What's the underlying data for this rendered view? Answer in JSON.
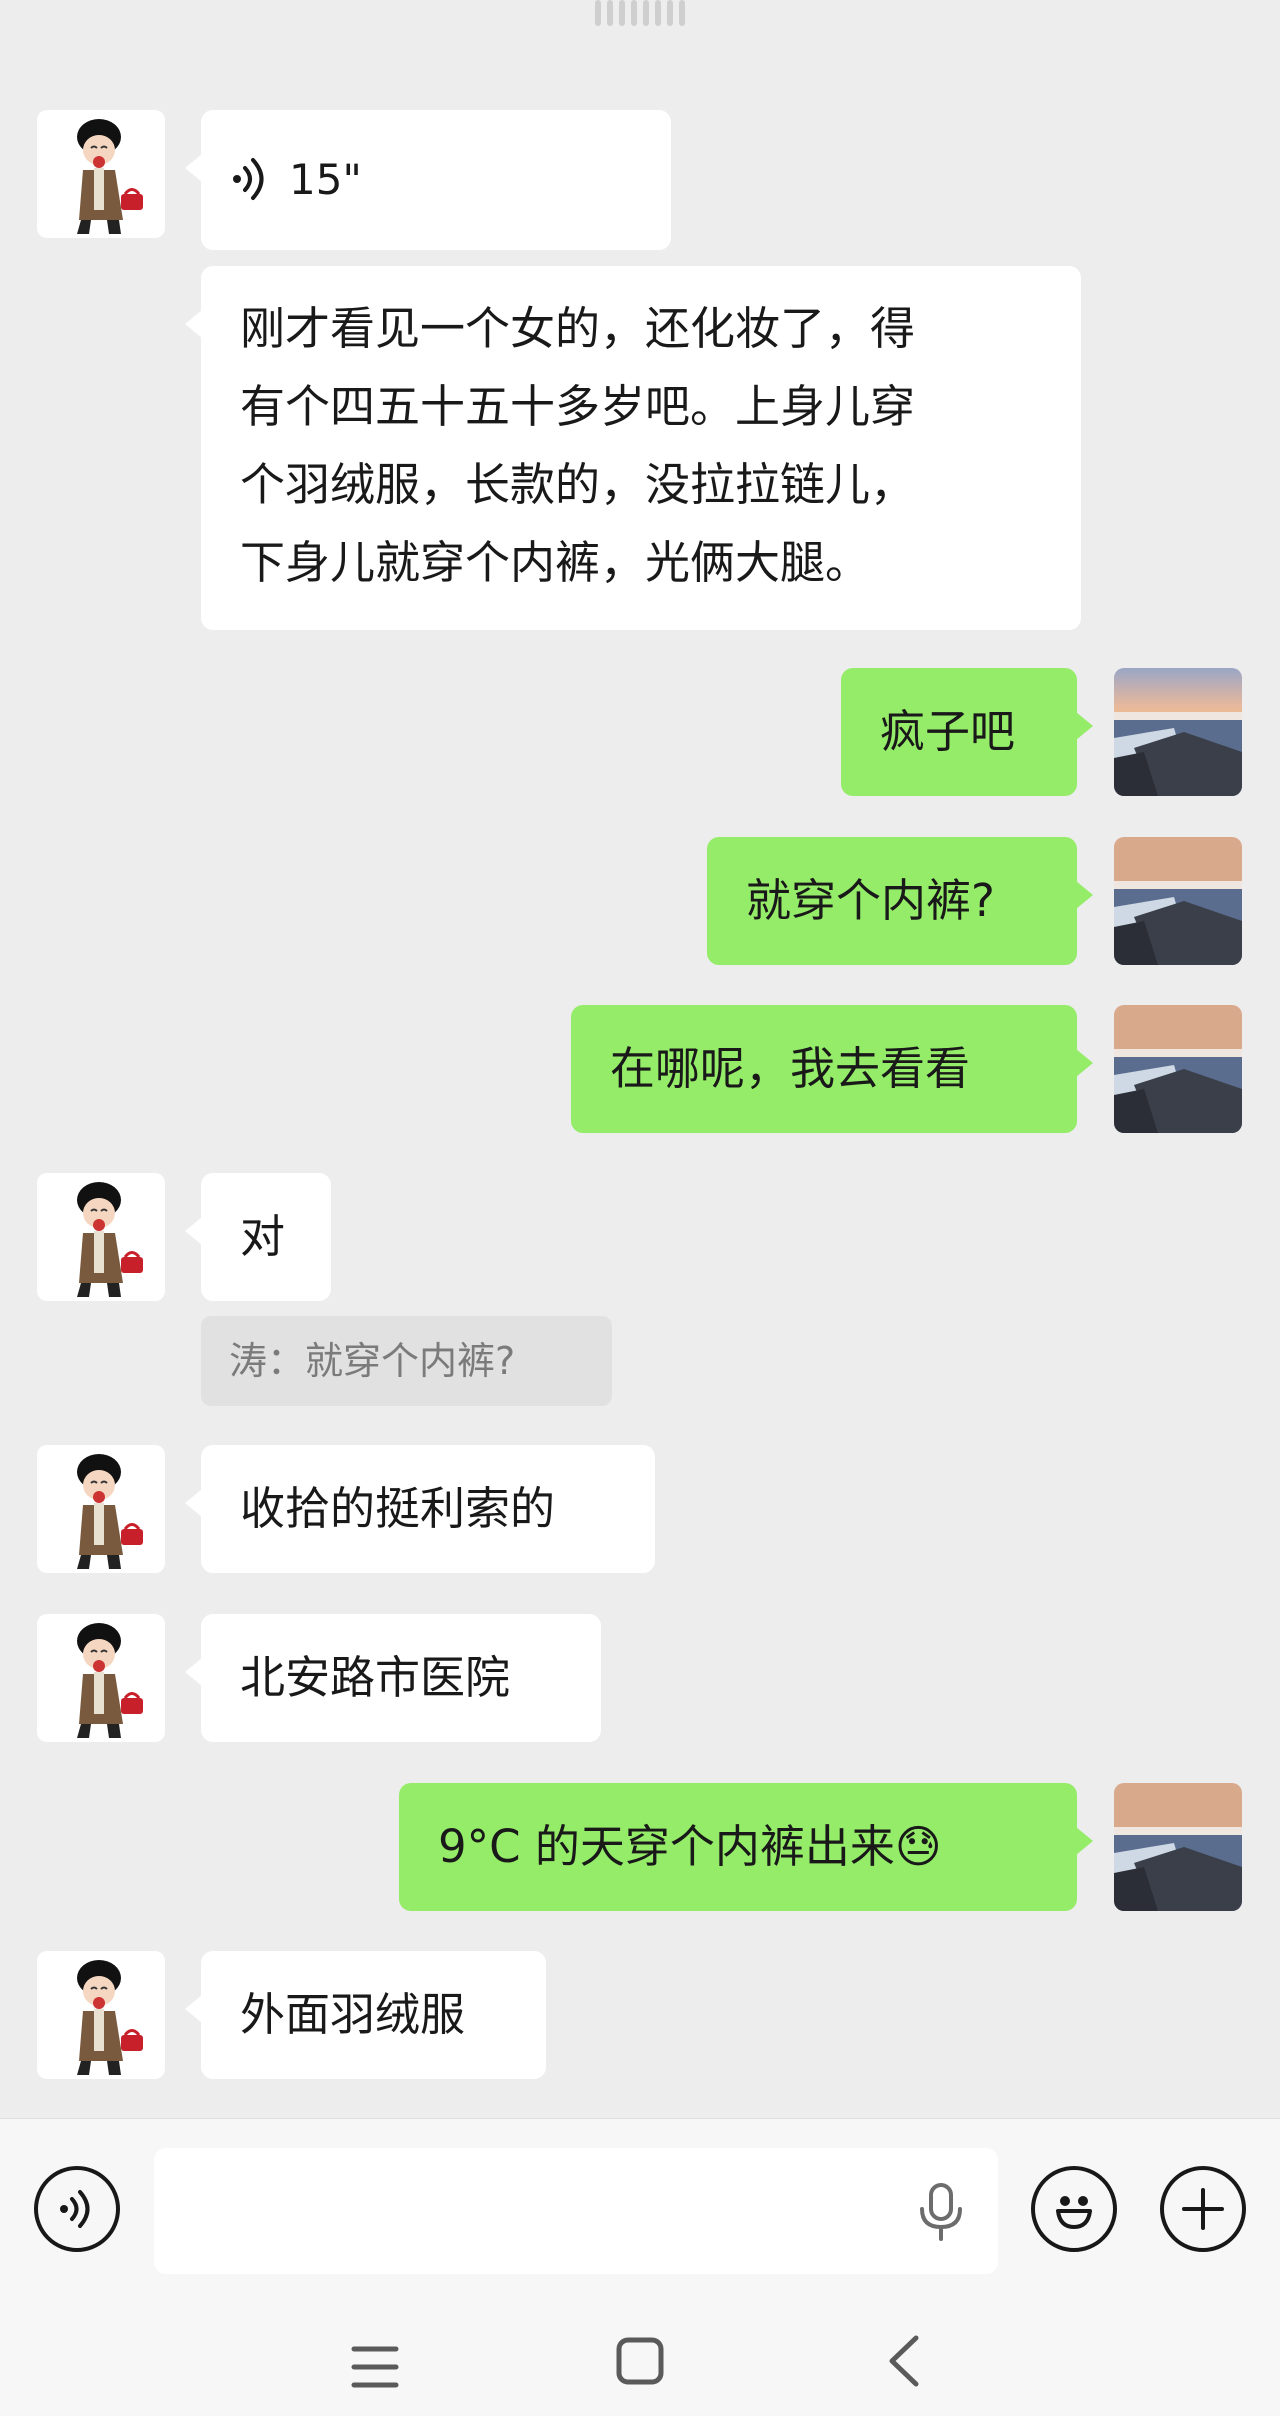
{
  "messages": [
    {
      "side": "left",
      "type": "voice",
      "duration": "15\""
    },
    {
      "side": "left",
      "type": "text",
      "text": "刚才看见一个女的，还化妆了，得\n有个四五十五十多岁吧。上身儿穿\n个羽绒服，长款的，没拉拉链儿，\n下身儿就穿个内裤，光俩大腿。"
    },
    {
      "side": "right",
      "type": "text",
      "text": "疯子吧"
    },
    {
      "side": "right",
      "type": "text",
      "text": "就穿个内裤?"
    },
    {
      "side": "right",
      "type": "text",
      "text": "在哪呢，我去看看"
    },
    {
      "side": "left",
      "type": "text",
      "text": "对"
    },
    {
      "side": "left",
      "type": "quote",
      "text": "涛：就穿个内裤?"
    },
    {
      "side": "left",
      "type": "text",
      "text": "收拾的挺利索的"
    },
    {
      "side": "left",
      "type": "text",
      "text": "北安路市医院"
    },
    {
      "side": "right",
      "type": "text",
      "text": "9°C 的天穿个内裤出来😓"
    },
    {
      "side": "left",
      "type": "text",
      "text": "外面羽绒服"
    }
  ],
  "input_bar": {
    "placeholder": "",
    "icons": [
      "voice-mode-icon",
      "microphone-icon",
      "emoji-icon",
      "plus-icon"
    ]
  },
  "nav_bar": {
    "icons": [
      "menu-icon",
      "home-icon",
      "back-icon"
    ]
  },
  "colors": {
    "background": "#ededed",
    "incoming_bubble": "#ffffff",
    "outgoing_bubble": "#95ec69"
  }
}
